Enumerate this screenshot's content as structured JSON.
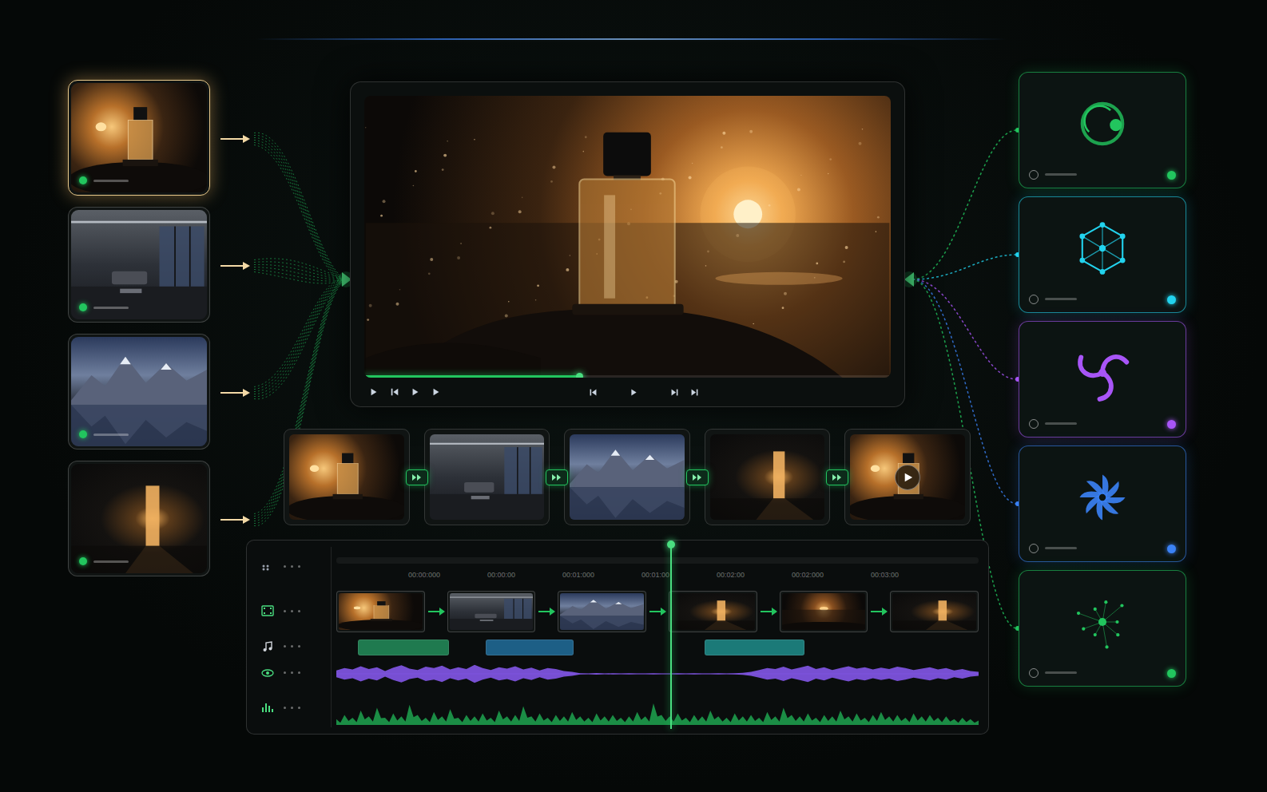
{
  "sources": [
    {
      "selected": true
    },
    {
      "selected": false
    },
    {
      "selected": false
    },
    {
      "selected": false
    }
  ],
  "preview": {
    "progress": 0.41
  },
  "storyboard": [
    {
      "kind": "still"
    },
    {
      "kind": "still"
    },
    {
      "kind": "still"
    },
    {
      "kind": "still"
    },
    {
      "kind": "video"
    }
  ],
  "timeline": {
    "ruler": [
      "00:00:000",
      "00:00:00",
      "00:01:000",
      "00:01:00",
      "00:02:00",
      "00:02:000",
      "00:03:00"
    ],
    "playhead": 0.52,
    "tracks": [
      {
        "kind": "video",
        "clips": [
          {
            "kind": "clip"
          },
          {
            "kind": "clip"
          },
          {
            "kind": "clip"
          },
          {
            "kind": "clip"
          },
          {
            "kind": "clip"
          },
          {
            "kind": "clip"
          }
        ]
      },
      {
        "kind": "audio",
        "clips": [
          {
            "start": 0.034,
            "end": 0.176,
            "color": "#1f7a4f"
          },
          {
            "start": 0.232,
            "end": 0.369,
            "color": "#1d5f86"
          },
          {
            "start": 0.574,
            "end": 0.729,
            "color": "#1b7a78"
          }
        ]
      },
      {
        "kind": "voice",
        "color": "#8b5cf6",
        "levels": [
          0.35,
          0.6,
          0.45,
          0.8,
          0.5,
          0.7,
          0.3,
          0.65,
          0.9,
          0.55,
          0.4,
          0.75,
          0.6,
          0.85,
          0.45,
          0.7,
          0.5,
          0.95,
          0.6,
          0.4,
          0.7,
          0.55,
          0.8,
          0.45,
          0.65,
          0.35,
          0.6,
          0.5,
          0.3,
          0.2,
          0.06,
          0.05,
          0.08,
          0.04,
          0.06,
          0.05,
          0.07,
          0.04,
          0.05,
          0.06,
          0.05,
          0.04,
          0.07,
          0.05,
          0.06,
          0.04,
          0.05,
          0.06,
          0.05,
          0.07,
          0.1,
          0.2,
          0.4,
          0.6,
          0.5,
          0.75,
          0.45,
          0.65,
          0.85,
          0.5,
          0.7,
          0.4,
          0.6,
          0.8,
          0.55,
          0.7,
          0.45,
          0.65,
          0.5,
          0.75,
          0.6,
          0.4,
          0.55,
          0.7,
          0.45,
          0.6,
          0.35,
          0.5,
          0.3,
          0.2
        ]
      },
      {
        "kind": "music",
        "color": "#22c55e",
        "levels": [
          0.2,
          0.35,
          0.25,
          0.5,
          0.3,
          0.6,
          0.25,
          0.4,
          0.3,
          0.7,
          0.35,
          0.25,
          0.45,
          0.3,
          0.55,
          0.25,
          0.35,
          0.3,
          0.4,
          0.25,
          0.5,
          0.3,
          0.35,
          0.65,
          0.3,
          0.4,
          0.25,
          0.35,
          0.3,
          0.45,
          0.3,
          0.25,
          0.4,
          0.3,
          0.35,
          0.25,
          0.3,
          0.45,
          0.3,
          0.75,
          0.35,
          0.3,
          0.4,
          0.25,
          0.35,
          0.3,
          0.5,
          0.3,
          0.25,
          0.4,
          0.3,
          0.35,
          0.25,
          0.45,
          0.3,
          0.6,
          0.35,
          0.3,
          0.4,
          0.25,
          0.35,
          0.3,
          0.5,
          0.3,
          0.4,
          0.25,
          0.35,
          0.45,
          0.3,
          0.35,
          0.25,
          0.4,
          0.3,
          0.35,
          0.25,
          0.3,
          0.2,
          0.25,
          0.2,
          0.15
        ]
      }
    ]
  },
  "effects": [
    {
      "kind": "orbit",
      "color": "#22c55e"
    },
    {
      "kind": "mesh",
      "color": "#22d3ee"
    },
    {
      "kind": "swirl",
      "color": "#a855f7"
    },
    {
      "kind": "fan",
      "color": "#3b82f6"
    },
    {
      "kind": "particles",
      "color": "#22c55e"
    }
  ]
}
